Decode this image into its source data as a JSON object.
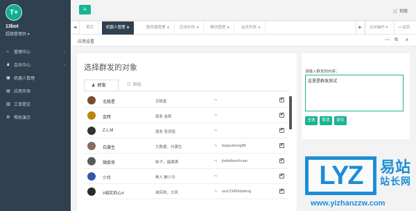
{
  "sidebar": {
    "avatar_text": "T+",
    "user_name": "13bot",
    "user_role": "超级管理员 ▾",
    "items": [
      {
        "label": "管理中心",
        "icon": "⌂",
        "has_arrow": true
      },
      {
        "label": "会员中心",
        "icon": "♟",
        "has_arrow": true
      },
      {
        "label": "机器人管理",
        "icon": "▣",
        "has_arrow": false
      },
      {
        "label": "应用市场",
        "icon": "▤",
        "has_arrow": false
      },
      {
        "label": "工单提交",
        "icon": "▥",
        "has_arrow": false
      },
      {
        "label": "帮助演示",
        "icon": "⚙",
        "has_arrow": false
      }
    ]
  },
  "topbar": {
    "menu_icon": "≡",
    "exit_label": "🛒 到商"
  },
  "tabs": {
    "prev_icon": "◀",
    "items": [
      {
        "label": "首页",
        "active": false
      },
      {
        "label": "机器人管理",
        "active": true
      },
      {
        "label": "服务器管理",
        "active": false
      },
      {
        "label": "应用市场",
        "active": false
      },
      {
        "label": "模块管理",
        "active": false
      },
      {
        "label": "会员列表",
        "active": false
      }
    ],
    "close_icon": "⊗",
    "next_icon": "▶",
    "close_ops": "关闭操作 ▾",
    "back_icon": "⇥",
    "back_label": "返回"
  },
  "panel": {
    "title": "应用设置",
    "minimize": "—",
    "restore": "⧉",
    "close": "✕"
  },
  "left": {
    "title": "选择群发的对象",
    "tab_friends": "好友",
    "tab_groups": "群组",
    "friend_icon": "♟",
    "group_icon": "☷",
    "rows": [
      {
        "name": "北极星",
        "nick": "北极星",
        "wx": "",
        "account": "",
        "checked": true,
        "color": "#7a4d2b"
      },
      {
        "name": "金辉",
        "nick": "朋友 金辉",
        "wx": "",
        "account": "",
        "checked": true,
        "color": "#b8860b"
      },
      {
        "name": "Z.L.M",
        "nick": "朋友 张进铭",
        "wx": "",
        "account": "",
        "checked": true,
        "color": "#333333"
      },
      {
        "name": "白袭生",
        "nick": "大数据，白袭生",
        "wx": "",
        "account": "baigusheng88",
        "checked": true,
        "color": "#8a6d5a"
      },
      {
        "name": "微股侠",
        "nick": "妹子，福满满",
        "wx": "",
        "account": "jiedaibaozhuan",
        "checked": true,
        "color": "#5a5a5a"
      },
      {
        "name": "少玲",
        "nick": "美人 歉少玲",
        "wx": "",
        "account": "",
        "checked": true,
        "color": "#3355aa"
      },
      {
        "name": "#诚实的心#",
        "nick": "诚实粉，大风",
        "wx": "",
        "account": "wo123456dafeng",
        "checked": true,
        "color": "#2a2a2a"
      }
    ],
    "wx_mark": "⇆",
    "check_mark": "✔"
  },
  "right": {
    "label": "请输入群发的内容：",
    "content": "这里是群发测试",
    "buttons": [
      "全选",
      "取消",
      "提交"
    ]
  },
  "watermark": {
    "logo": "LYZ",
    "cn1": "易站",
    "cn2": "站长网",
    "url": "www.yizhanzzw.com"
  }
}
